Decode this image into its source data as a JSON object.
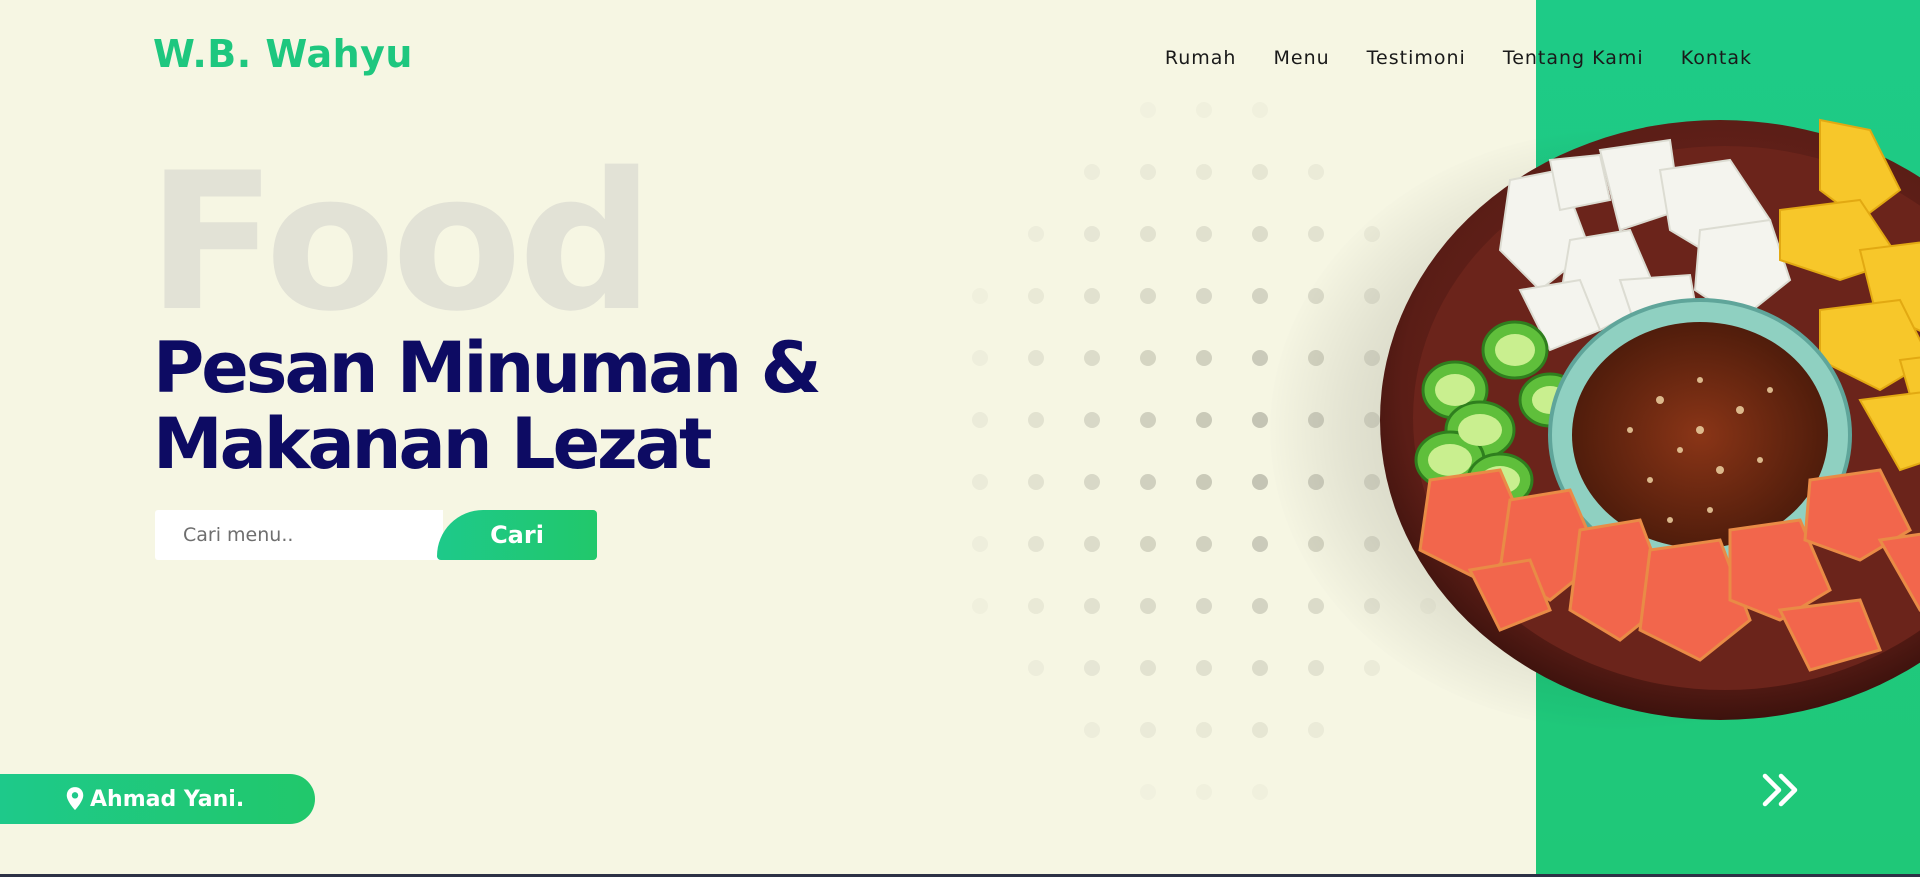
{
  "brand": {
    "name": "W.B. Wahyu",
    "color": "#1ec77f"
  },
  "nav": {
    "items": [
      {
        "label": "Rumah"
      },
      {
        "label": "Menu"
      },
      {
        "label": "Testimoni"
      },
      {
        "label": "Tentang Kami"
      },
      {
        "label": "Kontak"
      }
    ]
  },
  "hero": {
    "background_word": "Food",
    "headline_line1": "Pesan Minuman &",
    "headline_line2": "Makanan Lezat"
  },
  "search": {
    "placeholder": "Cari menu..",
    "value": "",
    "button_label": "Cari"
  },
  "location": {
    "label": "Ahmad Yani.",
    "icon": "map-pin-icon"
  },
  "navigation": {
    "next_icon": "double-chevron-right-icon"
  },
  "colors": {
    "accent": "#1ec77f",
    "background": "#f6f6e3",
    "headline": "#0d0b63",
    "panel": "#1ecb87"
  }
}
